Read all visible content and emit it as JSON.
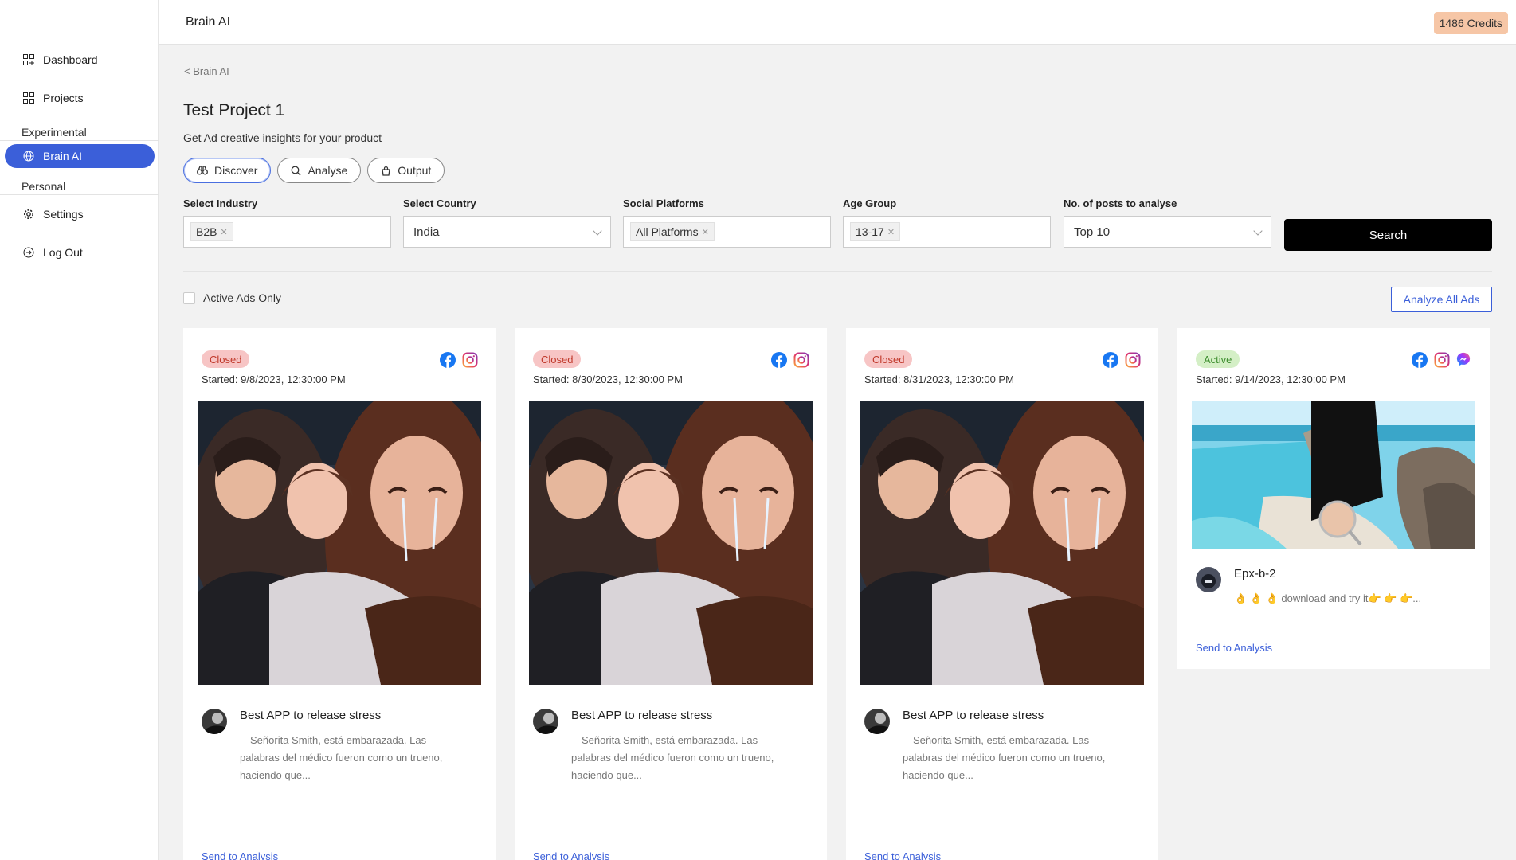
{
  "sidebar": {
    "items": [
      {
        "label": "Dashboard",
        "icon": "dashboard-icon"
      },
      {
        "label": "Projects",
        "icon": "grid-icon"
      }
    ],
    "section_experimental": "Experimental",
    "brain_ai": {
      "label": "Brain AI",
      "icon": "globe-icon"
    },
    "section_personal": "Personal",
    "settings": {
      "label": "Settings",
      "icon": "gear-icon"
    },
    "logout": {
      "label": "Log Out",
      "icon": "logout-icon"
    }
  },
  "header": {
    "title": "Brain AI",
    "credits": "1486 Credits"
  },
  "breadcrumb": "< Brain AI",
  "page": {
    "title": "Test Project 1",
    "subtitle": "Get Ad creative insights for your product"
  },
  "tabs": [
    {
      "label": "Discover",
      "icon": "binoculars-icon",
      "active": true
    },
    {
      "label": "Analyse",
      "icon": "search-icon",
      "active": false
    },
    {
      "label": "Output",
      "icon": "bag-icon",
      "active": false
    }
  ],
  "filters": {
    "industry": {
      "label": "Select Industry",
      "tag": "B2B"
    },
    "country": {
      "label": "Select Country",
      "value": "India"
    },
    "platforms": {
      "label": "Social Platforms",
      "tag": "All Platforms"
    },
    "age": {
      "label": "Age Group",
      "tag": "13-17"
    },
    "posts": {
      "label": "No. of posts to analyse",
      "value": "Top 10"
    },
    "search_label": "Search"
  },
  "active_only_label": "Active Ads Only",
  "analyze_all_label": "Analyze All Ads",
  "cards": [
    {
      "status": "Closed",
      "started": "Started: 9/8/2023, 12:30:00 PM",
      "platforms": [
        "facebook-icon",
        "instagram-icon"
      ],
      "title": "Best APP to release stress",
      "desc": "—Señorita Smith, está embarazada. Las palabras del médico fueron como un trueno, haciendo que...",
      "send": "Send to Analysis"
    },
    {
      "status": "Closed",
      "started": "Started: 8/30/2023, 12:30:00 PM",
      "platforms": [
        "facebook-icon",
        "instagram-icon"
      ],
      "title": "Best APP to release stress",
      "desc": "—Señorita Smith, está embarazada. Las palabras del médico fueron como un trueno, haciendo que...",
      "send": "Send to Analysis"
    },
    {
      "status": "Closed",
      "started": "Started: 8/31/2023, 12:30:00 PM",
      "platforms": [
        "facebook-icon",
        "instagram-icon"
      ],
      "title": "Best APP to release stress",
      "desc": "—Señorita Smith, está embarazada. Las palabras del médico fueron como un trueno, haciendo que...",
      "send": "Send to Analysis"
    },
    {
      "status": "Active",
      "started": "Started: 9/14/2023, 12:30:00 PM",
      "platforms": [
        "facebook-icon",
        "instagram-icon",
        "messenger-icon"
      ],
      "title": "Epx-b-2",
      "desc": "👌 👌 👌 download and try it👉 👉 👉...",
      "send": "Send to Analysis"
    }
  ],
  "colors": {
    "accent": "#3b5fd9",
    "closed_badge_bg": "#f7c5c5",
    "active_badge_bg": "#d4efc6",
    "credits_bg": "#f6c6a6"
  }
}
